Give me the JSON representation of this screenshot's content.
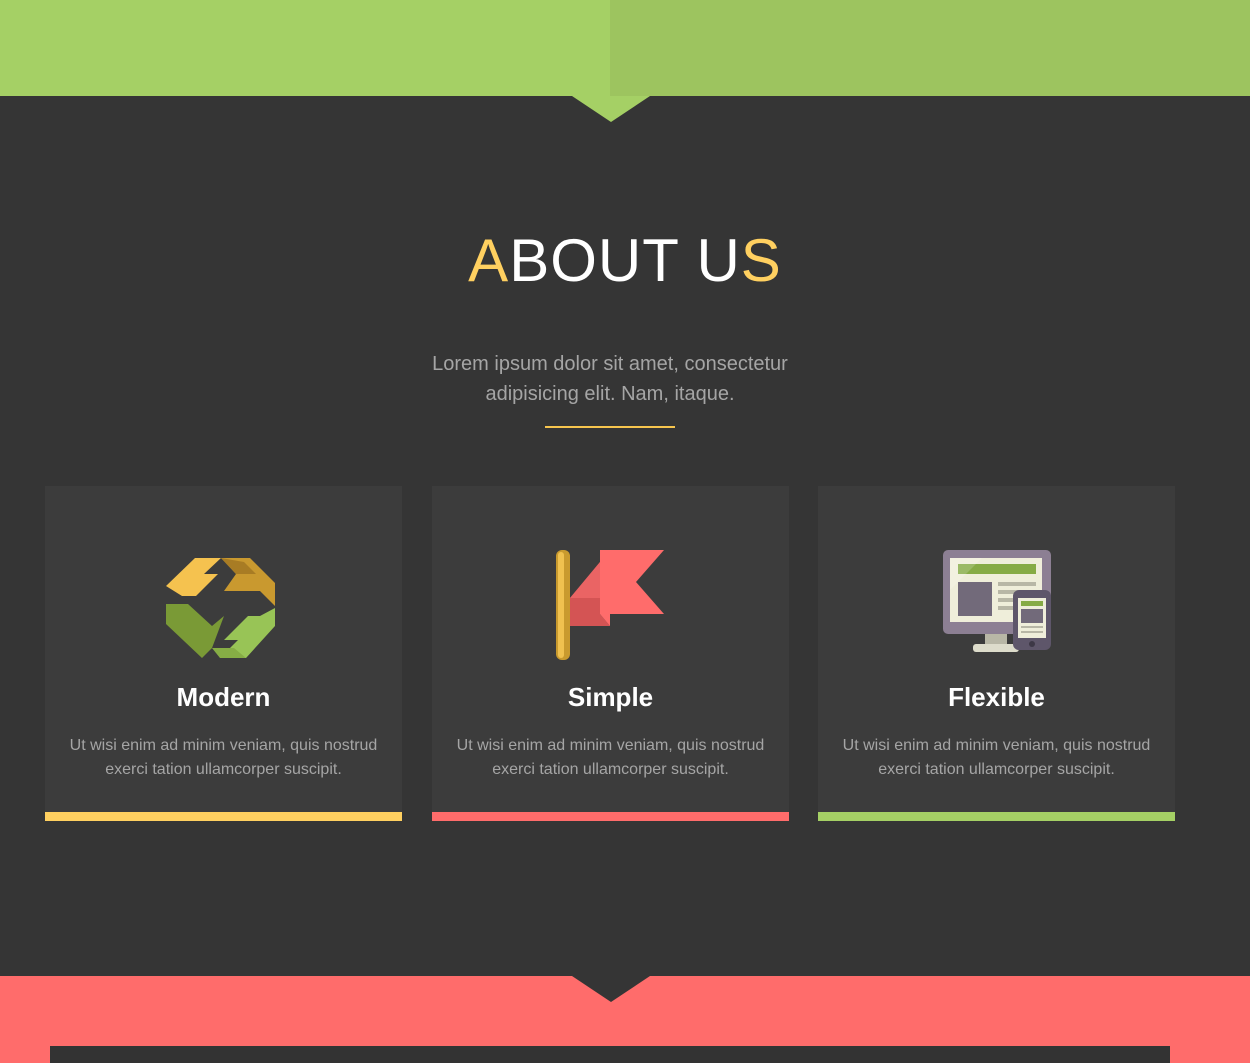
{
  "section": {
    "title_first": "A",
    "title_middle": "BOUT U",
    "title_last": "S",
    "subtitle": "Lorem ipsum dolor sit amet, consectetur adipisicing elit. Nam, itaque."
  },
  "features": [
    {
      "icon": "refresh-icon",
      "title": "Modern",
      "text": "Ut wisi enim ad minim veniam, quis nostrud exerci tation ullamcorper suscipit.",
      "accent": "#ffd060"
    },
    {
      "icon": "flag-icon",
      "title": "Simple",
      "text": "Ut wisi enim ad minim veniam, quis nostrud exerci tation ullamcorper suscipit.",
      "accent": "#ff6c6b"
    },
    {
      "icon": "responsive-devices-icon",
      "title": "Flexible",
      "text": "Ut wisi enim ad minim veniam, quis nostrud exerci tation ullamcorper suscipit.",
      "accent": "#a5d065"
    }
  ],
  "colors": {
    "background": "#353535",
    "card": "#3c3c3c",
    "green": "#a5d065",
    "yellow": "#ffd060",
    "coral": "#ff6c6b"
  }
}
